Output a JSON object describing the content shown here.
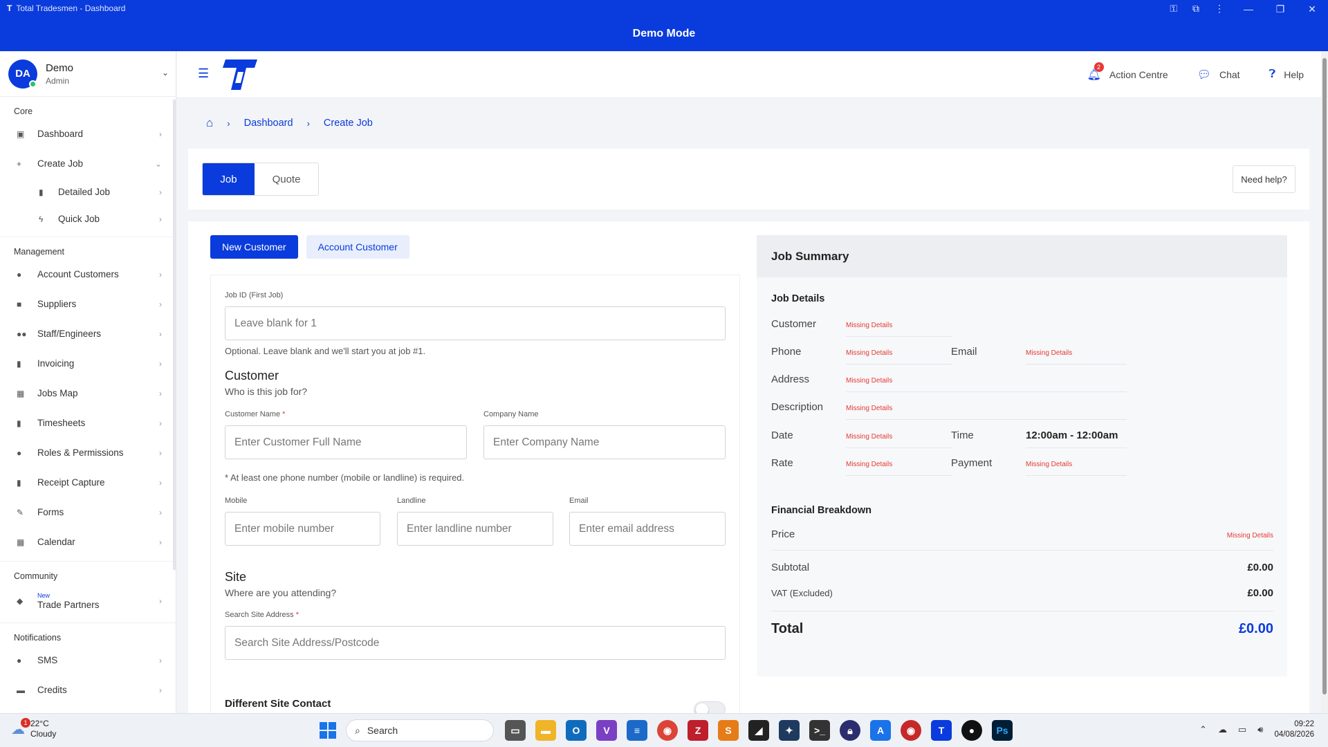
{
  "window": {
    "title": "Total Tradesmen - Dashboard",
    "mode_banner": "Demo Mode"
  },
  "user": {
    "initials": "DA",
    "name": "Demo",
    "role": "Admin"
  },
  "sidebar": {
    "sections": {
      "core": "Core",
      "management": "Management",
      "community": "Community",
      "notifications": "Notifications"
    },
    "core_items": [
      {
        "label": "Dashboard",
        "icon": "dashboard-icon"
      },
      {
        "label": "Create Job",
        "icon": "plus-icon"
      }
    ],
    "create_job_sub": [
      {
        "label": "Detailed Job",
        "icon": "document-icon"
      },
      {
        "label": "Quick Job",
        "icon": "bolt-icon"
      }
    ],
    "management_items": [
      {
        "label": "Account Customers",
        "icon": "user-icon"
      },
      {
        "label": "Suppliers",
        "icon": "truck-icon"
      },
      {
        "label": "Staff/Engineers",
        "icon": "users-icon"
      },
      {
        "label": "Invoicing",
        "icon": "invoice-icon"
      },
      {
        "label": "Jobs Map",
        "icon": "map-icon"
      },
      {
        "label": "Timesheets",
        "icon": "timesheet-icon"
      },
      {
        "label": "Roles & Permissions",
        "icon": "user-shield-icon"
      },
      {
        "label": "Receipt Capture",
        "icon": "receipt-icon"
      },
      {
        "label": "Forms",
        "icon": "form-icon"
      },
      {
        "label": "Calendar",
        "icon": "calendar-icon"
      }
    ],
    "community_item": {
      "tag": "New",
      "label": "Trade Partners",
      "icon": "handshake-icon"
    },
    "notification_items": [
      {
        "label": "SMS",
        "icon": "sms-icon"
      },
      {
        "label": "Credits",
        "icon": "credits-icon"
      }
    ]
  },
  "header": {
    "action_centre": "Action Centre",
    "action_badge": "2",
    "chat": "Chat",
    "help": "Help"
  },
  "breadcrumb": {
    "dashboard": "Dashboard",
    "current": "Create Job"
  },
  "tabs": {
    "job": "Job",
    "quote": "Quote",
    "need_help": "Need help?"
  },
  "customer_tabs": {
    "new": "New Customer",
    "account": "Account Customer"
  },
  "form": {
    "job_id_label": "Job ID (First Job)",
    "job_id_placeholder": "Leave blank for 1",
    "job_id_hint": "Optional. Leave blank and we'll start you at job #1.",
    "customer_heading": "Customer",
    "customer_sub": "Who is this job for?",
    "customer_name_label": "Customer Name",
    "customer_name_placeholder": "Enter Customer Full Name",
    "company_name_label": "Company Name",
    "company_name_placeholder": "Enter Company Name",
    "phone_note": "* At least one phone number (mobile or landline) is required.",
    "mobile_label": "Mobile",
    "mobile_placeholder": "Enter mobile number",
    "landline_label": "Landline",
    "landline_placeholder": "Enter landline number",
    "email_label": "Email",
    "email_placeholder": "Enter email address",
    "site_heading": "Site",
    "site_sub": "Where are you attending?",
    "site_search_label": "Search Site Address",
    "site_search_placeholder": "Search Site Address/Postcode",
    "different_contact": "Different Site Contact",
    "required_mark": "*"
  },
  "summary": {
    "title": "Job Summary",
    "job_details": "Job Details",
    "missing": "Missing Details",
    "customer": "Customer",
    "phone": "Phone",
    "email": "Email",
    "address": "Address",
    "description": "Description",
    "date": "Date",
    "time": "Time",
    "time_value": "12:00am - 12:00am",
    "rate": "Rate",
    "payment": "Payment",
    "financial": "Financial Breakdown",
    "price": "Price",
    "subtotal": "Subtotal",
    "subtotal_value": "£0.00",
    "vat": "VAT (Excluded)",
    "vat_value": "£0.00",
    "total": "Total",
    "total_value": "£0.00"
  },
  "taskbar": {
    "temp": "22°C",
    "weather": "Cloudy",
    "weather_badge": "1",
    "search": "Search",
    "time": "09:22",
    "date": "04/08/2026"
  },
  "colors": {
    "brand": "#0a3bdc",
    "missing": "#e53935"
  }
}
